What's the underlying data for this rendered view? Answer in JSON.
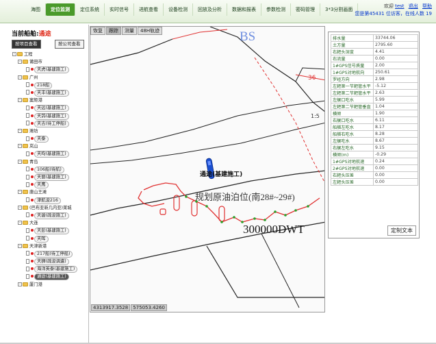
{
  "nav": {
    "tabs": [
      "海图",
      "定位监测",
      "定位系统",
      "实时信号",
      "进航查看",
      "设备检测",
      "回放及分析",
      "数据和报表",
      "参数检测",
      "密码管理",
      "3*3分割画面"
    ],
    "active_index": 1,
    "welcome": "欢迎",
    "user": "test",
    "logout": "退出",
    "help": "帮助",
    "visitor_line": "您是第45431 位访客，在线人数 19"
  },
  "left": {
    "current_label": "当前船舶:",
    "current_ship": "通途",
    "btn_by_project": "按项目查看",
    "btn_by_company": "按公司查看",
    "tree": [
      {
        "level": 0,
        "kind": "folder",
        "label": "工程"
      },
      {
        "level": 1,
        "kind": "folder",
        "label": "莆田市"
      },
      {
        "level": 2,
        "kind": "ship",
        "label": "天虎(基建施工)"
      },
      {
        "level": 1,
        "kind": "folder",
        "label": "广州"
      },
      {
        "level": 2,
        "kind": "ship",
        "label": "218船"
      },
      {
        "level": 2,
        "kind": "ship",
        "label": "天丰(基建施工)"
      },
      {
        "level": 1,
        "kind": "folder",
        "label": "案矩港"
      },
      {
        "level": 2,
        "kind": "ship",
        "label": "天远(基建施工)"
      },
      {
        "level": 2,
        "kind": "ship",
        "label": "天鸽(基建施工)"
      },
      {
        "level": 2,
        "kind": "ship",
        "label": "天吉(待工停船)"
      },
      {
        "level": 1,
        "kind": "folder",
        "label": "潍坊"
      },
      {
        "level": 2,
        "kind": "ship",
        "label": "天泰"
      },
      {
        "level": 1,
        "kind": "folder",
        "label": "岚山"
      },
      {
        "level": 2,
        "kind": "ship",
        "label": "天昀(基建施工)"
      },
      {
        "level": 1,
        "kind": "folder",
        "label": "青岛"
      },
      {
        "level": 2,
        "kind": "ship",
        "label": "106船(待航)"
      },
      {
        "level": 2,
        "kind": "ship",
        "label": "天丽(基建施工)"
      },
      {
        "level": 2,
        "kind": "ship",
        "label": "天鹰"
      },
      {
        "level": 1,
        "kind": "folder",
        "label": "唐山王滩"
      },
      {
        "level": 2,
        "kind": "ship",
        "label": "津航浚216"
      },
      {
        "level": 1,
        "kind": "folder",
        "label": "(巴布亚新几内亚)莱城"
      },
      {
        "level": 2,
        "kind": "ship",
        "label": "天骏(疏浚施工)"
      },
      {
        "level": 1,
        "kind": "folder",
        "label": "大连"
      },
      {
        "level": 2,
        "kind": "ship",
        "label": "天彭(基建施工)"
      },
      {
        "level": 2,
        "kind": "ship",
        "label": "天晖"
      },
      {
        "level": 1,
        "kind": "folder",
        "label": "天津新港"
      },
      {
        "level": 2,
        "kind": "ship",
        "label": "217船(待工停船)"
      },
      {
        "level": 2,
        "kind": "ship",
        "label": "天狮(疏浚调遣)"
      },
      {
        "level": 2,
        "kind": "ship",
        "label": "海洋英泰(基建施工)"
      },
      {
        "level": 2,
        "kind": "ship",
        "label": "通途(基建施工)",
        "selected": true
      },
      {
        "level": 1,
        "kind": "folder",
        "label": "厦门港"
      }
    ]
  },
  "map": {
    "tabs": [
      "恢复",
      "跟踪",
      "测量",
      "48H轨迹"
    ],
    "active_tab": 1,
    "label_bs": "BS",
    "label_36": "36",
    "label_scale": "1:5",
    "label_ship": "通途(基建施工)",
    "label_berth": "规划原油泊位(南28#~29#)",
    "label_dwt": "300000DWT",
    "coord_x": "4313917.3528",
    "coord_y": "575053.4260"
  },
  "data_panel": {
    "rows": [
      [
        "排水量",
        "33744.06"
      ],
      [
        "土方量",
        "2795.60"
      ],
      [
        "右耙头深度",
        "4.41"
      ],
      [
        "右流量",
        "0.00"
      ],
      [
        "1#GPS信号质量",
        "2.00"
      ],
      [
        "1#GPS对地航向",
        "250.61"
      ],
      [
        "罗经方向",
        "2.98"
      ],
      [
        "左耙第一节耙管水平",
        "-5.12"
      ],
      [
        "左耙第二节耙管水平",
        "2.63"
      ],
      [
        "左艉口吃水",
        "5.99"
      ],
      [
        "左耙第二节耙管垂直",
        "1.04"
      ],
      [
        "横倾",
        "1.90"
      ],
      [
        "右艉口吃水",
        "6.11"
      ],
      [
        "船艏左吃水",
        "8.17"
      ],
      [
        "船艏右吃水",
        "8.28"
      ],
      [
        "左艉吃水",
        "8.67"
      ],
      [
        "右艉左吃水",
        "9.15"
      ],
      [
        "横倾(m)",
        "-0.29"
      ],
      [
        "1#GPS对地航速",
        "0.24"
      ],
      [
        "2#GPS对地航速",
        "0.00"
      ],
      [
        "右耙头压差",
        "0.00"
      ],
      [
        "左耙头压差",
        "0.00"
      ]
    ],
    "btn_custom": "定制文本"
  },
  "colors": {
    "accent": "#4a9a2a",
    "ship_name_red": "#e03020",
    "route_red": "#e03030",
    "map_grid": "#222222",
    "ship_blue": "#1a4fd0"
  }
}
